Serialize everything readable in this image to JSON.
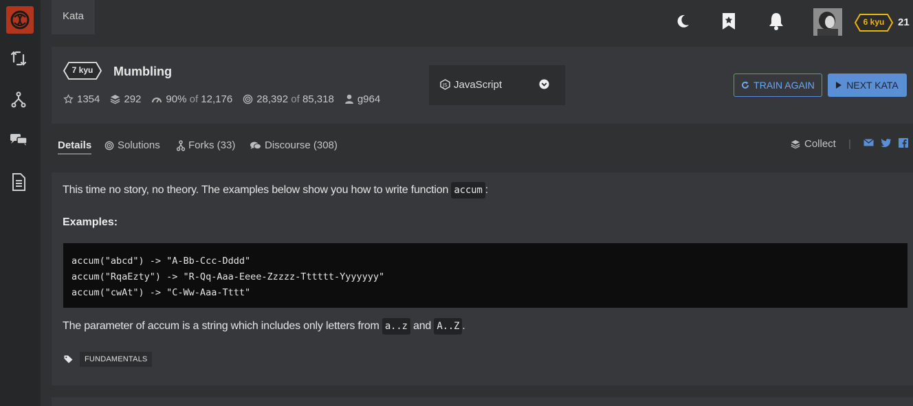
{
  "nav": {
    "kata_tab": "Kata"
  },
  "user": {
    "rank": "6 kyu",
    "honor": "21"
  },
  "kata": {
    "rank": "7 kyu",
    "title": "Mumbling",
    "stars": "1354",
    "collections": "292",
    "satisfaction": "90%",
    "satisfaction_of": "of",
    "satisfaction_votes": "12,176",
    "completed": "28,392",
    "completed_of": "of",
    "attempted": "85,318",
    "author": "g964"
  },
  "language": {
    "selected": "JavaScript"
  },
  "actions": {
    "train_again": "TRAIN AGAIN",
    "next_kata": "NEXT KATA"
  },
  "tabs": [
    {
      "label": "Details"
    },
    {
      "label": "Solutions"
    },
    {
      "label": "Forks (33)"
    },
    {
      "label": "Discourse (308)"
    }
  ],
  "collect_label": "Collect",
  "description": {
    "intro_before": "This time no story, no theory. The examples below show you how to write function ",
    "intro_code": "accum",
    "intro_after": ":",
    "examples_heading": "Examples:",
    "code_lines": [
      "accum(\"abcd\") -> \"A-Bb-Ccc-Dddd\"",
      "accum(\"RqaEzty\") -> \"R-Qq-Aaa-Eeee-Zzzzz-Tttttt-Yyyyyyy\"",
      "accum(\"cwAt\") -> \"C-Ww-Aaa-Tttt\""
    ],
    "param_before": "The parameter of accum is a string which includes only letters from ",
    "param_code1": "a..z",
    "param_mid": " and ",
    "param_code2": "A..Z",
    "param_after": "."
  },
  "tags": [
    "FUNDAMENTALS"
  ],
  "colors": {
    "accent_blue": "#5a8fd6",
    "rank_yellow": "#ecb613",
    "logo_red": "#b1361e"
  }
}
